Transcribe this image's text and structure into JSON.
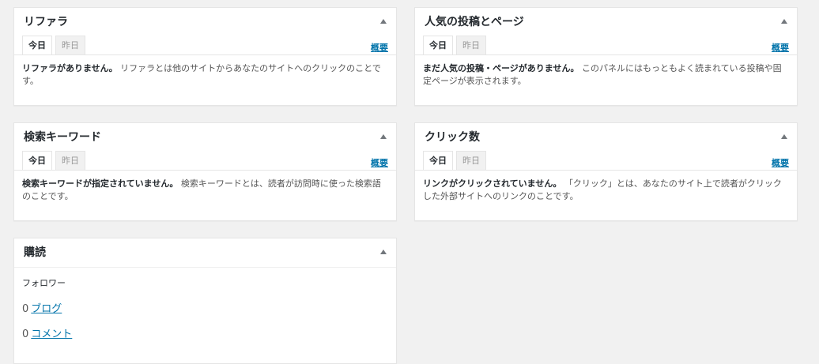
{
  "panels": {
    "referrers": {
      "title": "リファラ",
      "tabs": [
        "今日",
        "昨日"
      ],
      "overview_link": "概要",
      "message_strong": "リファラがありません。",
      "message_text": " リファラとは他のサイトからあなたのサイトへのクリックのことです。"
    },
    "popular": {
      "title": "人気の投稿とページ",
      "tabs": [
        "今日",
        "昨日"
      ],
      "overview_link": "概要",
      "message_strong": "まだ人気の投稿・ページがありません。",
      "message_text": " このパネルにはもっともよく読まれている投稿や固定ページが表示されます。"
    },
    "search_terms": {
      "title": "検索キーワード",
      "tabs": [
        "今日",
        "昨日"
      ],
      "overview_link": "概要",
      "message_strong": "検索キーワードが指定されていません。",
      "message_text": " 検索キーワードとは、読者が訪問時に使った検索語のことです。"
    },
    "clicks": {
      "title": "クリック数",
      "tabs": [
        "今日",
        "昨日"
      ],
      "overview_link": "概要",
      "message_strong": "リンクがクリックされていません。",
      "message_text": " 「クリック」とは、あなたのサイト上で読者がクリックした外部サイトへのリンクのことです。"
    },
    "subscriptions": {
      "title": "購読",
      "followers_label": "フォロワー",
      "rows": [
        {
          "count": "0",
          "label": "ブログ"
        },
        {
          "count": "0",
          "label": "コメント"
        }
      ]
    }
  },
  "colors": {
    "background": "#f1f1f1",
    "panel": "#ffffff",
    "link": "#0073aa",
    "border": "#e5e5e5"
  },
  "icons": {
    "panel_toggle": "triangle-up-icon"
  }
}
